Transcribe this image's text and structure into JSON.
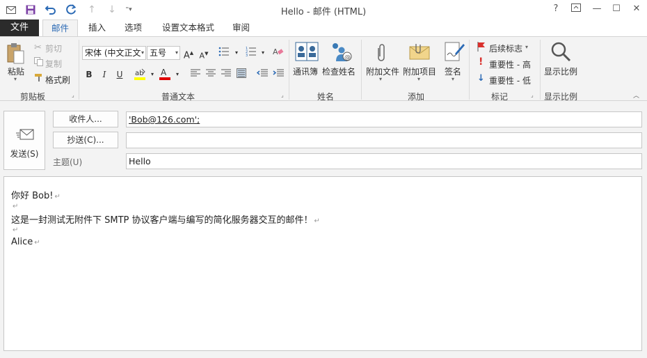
{
  "window": {
    "title": "Hello - 邮件 (HTML)",
    "help": "?",
    "restore_ribbon": "⧉",
    "minimize": "—",
    "maximize": "☐",
    "close": "✕"
  },
  "quick_access": {
    "items": [
      "mail-icon",
      "save-icon",
      "undo-icon",
      "redo-icon",
      "up-arrow-icon",
      "down-arrow-icon",
      "customize-icon"
    ]
  },
  "tabs": {
    "file": "文件",
    "items": [
      {
        "label": "邮件",
        "active": true
      },
      {
        "label": "插入",
        "active": false
      },
      {
        "label": "选项",
        "active": false
      },
      {
        "label": "设置文本格式",
        "active": false
      },
      {
        "label": "审阅",
        "active": false
      }
    ]
  },
  "ribbon": {
    "clipboard": {
      "label": "剪贴板",
      "paste": "粘贴",
      "cut": "剪切",
      "copy": "复制",
      "format_painter": "格式刷"
    },
    "basic_text": {
      "label": "普通文本",
      "font": "宋体 (中文正文",
      "size": "五号",
      "bold": "B",
      "italic": "I",
      "underline": "U"
    },
    "names": {
      "label": "姓名",
      "address_book": "通讯簿",
      "check_names": "检查姓名"
    },
    "include": {
      "label": "添加",
      "attach_file": "附加文件",
      "attach_item": "附加项目",
      "signature": "签名"
    },
    "tags": {
      "label": "标记",
      "follow_up": "后续标志",
      "high": "重要性 - 高",
      "low": "重要性 - 低"
    },
    "zoom": {
      "label": "显示比例",
      "zoom": "显示比例"
    }
  },
  "header": {
    "send": "发送(S)",
    "to_button": "收件人...",
    "cc_button": "抄送(C)...",
    "subject_label": "主题(U)",
    "to_value": "'Bob@126.com';",
    "cc_value": "",
    "subject_value": "Hello"
  },
  "body": {
    "lines": [
      "你好  Bob!",
      "",
      "这是一封测试无附件下 SMTP 协议客户端与编写的简化服务器交互的邮件！",
      "",
      "Alice"
    ],
    "para_mark": "↵"
  },
  "colors": {
    "accent": "#2b6ab5",
    "file_tab": "#2b2b2b",
    "highlight": "#ffff00",
    "font_color": "#e00000"
  }
}
